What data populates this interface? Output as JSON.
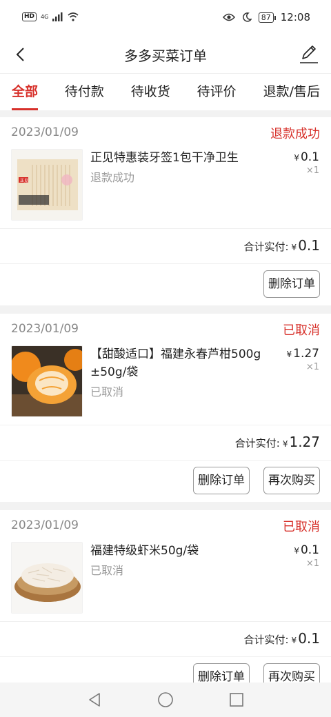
{
  "status_bar": {
    "network_badge": "HD",
    "signal_text": "4G",
    "battery": "87",
    "time": "12:08"
  },
  "nav": {
    "title": "多多买菜订单"
  },
  "tabs": [
    {
      "label": "全部",
      "active": true
    },
    {
      "label": "待付款",
      "active": false
    },
    {
      "label": "待收货",
      "active": false
    },
    {
      "label": "待评价",
      "active": false
    },
    {
      "label": "退款/售后",
      "active": false
    }
  ],
  "orders": [
    {
      "date": "2023/01/09",
      "status": "退款成功",
      "item_name": "正见特惠装牙签1包干净卫生",
      "item_sub": "退款成功",
      "currency": "¥",
      "price": "0.1",
      "qty": "×1",
      "total_label": "合计实付:",
      "total": "0.1",
      "thumb_text": "正见",
      "buttons": [
        "删除订单"
      ]
    },
    {
      "date": "2023/01/09",
      "status": "已取消",
      "item_name": "【甜酸适口】福建永春芦柑500g ±50g/袋",
      "item_sub": "已取消",
      "currency": "¥",
      "price": "1.27",
      "qty": "×1",
      "total_label": "合计实付:",
      "total": "1.27",
      "buttons": [
        "删除订单",
        "再次购买"
      ]
    },
    {
      "date": "2023/01/09",
      "status": "已取消",
      "item_name": "福建特级虾米50g/袋",
      "item_sub": "已取消",
      "currency": "¥",
      "price": "0.1",
      "qty": "×1",
      "total_label": "合计实付:",
      "total": "0.1",
      "buttons": [
        "删除订单",
        "再次购买"
      ]
    }
  ],
  "colors": {
    "accent": "#d7302a",
    "muted": "#999999"
  }
}
